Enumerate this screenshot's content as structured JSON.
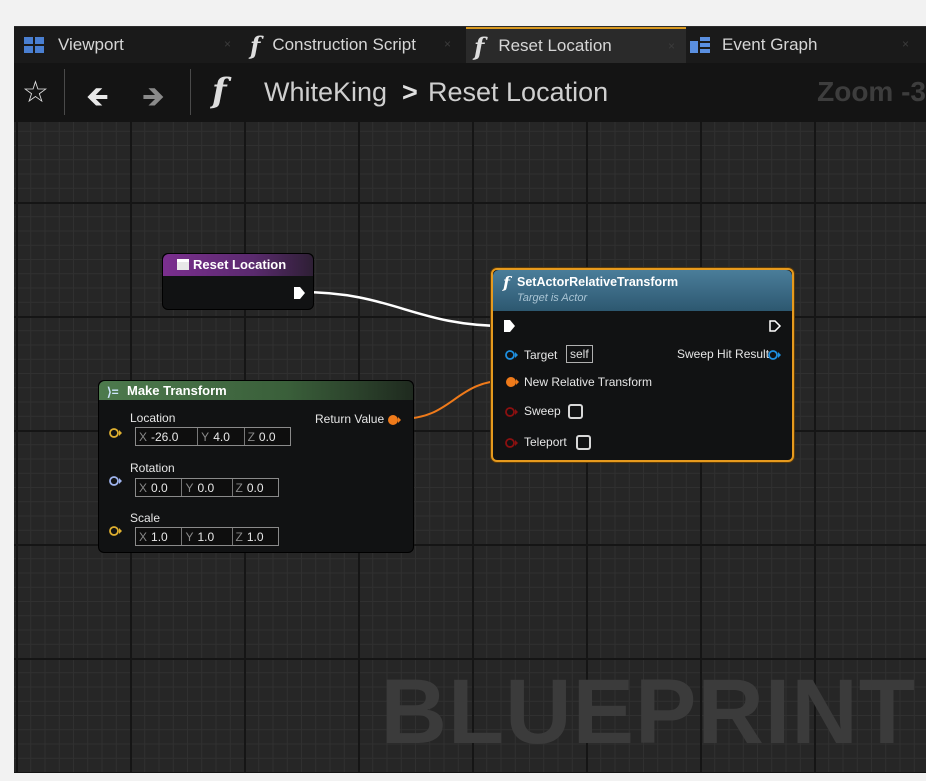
{
  "tabs": [
    {
      "label": "Viewport",
      "icon": "viewport-icon"
    },
    {
      "label": "Construction Script",
      "icon": "function-icon"
    },
    {
      "label": "Reset Location",
      "icon": "function-icon",
      "active": true
    },
    {
      "label": "Event Graph",
      "icon": "event-graph-icon"
    }
  ],
  "breadcrumb": {
    "blueprint": "WhiteKing",
    "separator": ">",
    "function": "Reset Location",
    "zoom": "Zoom -3"
  },
  "graph": {
    "watermark": "BLUEPRINT"
  },
  "nodes": {
    "entry": {
      "title": "Reset Location",
      "header_color": "#7b2f8f"
    },
    "set_actor": {
      "title": "SetActorRelativeTransform",
      "subtitle": "Target is Actor",
      "header_color": "#3b6b85",
      "selected_outline": "#e69a1e",
      "pins": {
        "target": "Target",
        "target_default": "self",
        "new_relative_transform": "New Relative Transform",
        "sweep": "Sweep",
        "teleport": "Teleport",
        "sweep_hit_result": "Sweep Hit Result"
      }
    },
    "make_transform": {
      "title": "Make Transform",
      "header_color": "#3f6a3f",
      "location_label": "Location",
      "location": {
        "x": "-26.0",
        "y": "4.0",
        "z": "0.0"
      },
      "rotation_label": "Rotation",
      "rotation": {
        "x": "0.0",
        "y": "0.0",
        "z": "0.0"
      },
      "scale_label": "Scale",
      "scale": {
        "x": "1.0",
        "y": "1.0",
        "z": "1.0"
      },
      "return_value": "Return Value"
    }
  },
  "axis_letters": {
    "x": "X",
    "y": "Y",
    "z": "Z"
  },
  "colors": {
    "exec_wire": "#ffffff",
    "transform_wire": "#ef7a1a",
    "object_pin": "#1e8fe0",
    "vector_pin": "#e0b030",
    "rotator_pin": "#9fb4ee",
    "bool_pin": "#8c1010"
  }
}
